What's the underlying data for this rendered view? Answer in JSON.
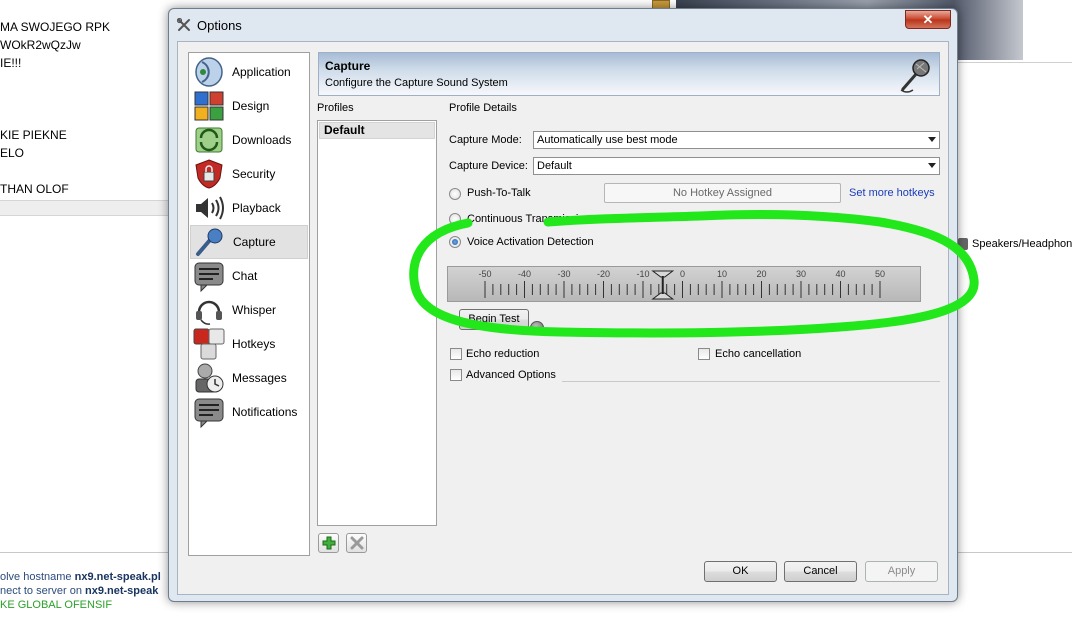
{
  "background": {
    "chat_lines": [
      "MA SWOJEGO RPK",
      "WOkR2wQzJw",
      "IE!!!",
      "KIE PIEKNE",
      "ELO",
      "THAN OLOF"
    ],
    "log": {
      "line1_prefix": "olve hostname ",
      "line1_host": "nx9.net-speak.pl",
      "line2_prefix": "nect to server on ",
      "line2_host": "nx9.net-speak",
      "line3": "KE GLOBAL OFENSIF"
    },
    "speakers_label": "Speakers/Headphone"
  },
  "dialog": {
    "title": "Options",
    "close_label": "✕"
  },
  "sidebar": {
    "items": [
      {
        "label": "Application",
        "icon": "application-icon"
      },
      {
        "label": "Design",
        "icon": "design-icon"
      },
      {
        "label": "Downloads",
        "icon": "downloads-icon"
      },
      {
        "label": "Security",
        "icon": "security-icon"
      },
      {
        "label": "Playback",
        "icon": "playback-icon"
      },
      {
        "label": "Capture",
        "icon": "capture-icon",
        "selected": true
      },
      {
        "label": "Chat",
        "icon": "chat-icon"
      },
      {
        "label": "Whisper",
        "icon": "whisper-icon"
      },
      {
        "label": "Hotkeys",
        "icon": "hotkeys-icon"
      },
      {
        "label": "Messages",
        "icon": "messages-icon"
      },
      {
        "label": "Notifications",
        "icon": "notifications-icon"
      }
    ]
  },
  "header": {
    "title": "Capture",
    "subtitle": "Configure the Capture Sound System"
  },
  "profiles": {
    "label": "Profiles",
    "items": [
      "Default"
    ]
  },
  "details": {
    "label": "Profile Details",
    "capture_mode_label": "Capture Mode:",
    "capture_mode_value": "Automatically use best mode",
    "capture_device_label": "Capture Device:",
    "capture_device_value": "Default",
    "push_to_talk_label": "Push-To-Talk",
    "hotkey_placeholder": "No Hotkey Assigned",
    "set_more_hotkeys": "Set more hotkeys",
    "continuous_label": "Continuous Transmission",
    "vad_label": "Voice Activation Detection",
    "selected_mode": "Voice Activation Detection",
    "vad_scale": {
      "ticks": [
        "-50",
        "-40",
        "-30",
        "-20",
        "-10",
        "0",
        "10",
        "20",
        "30",
        "40",
        "50"
      ],
      "min": -50,
      "max": 50,
      "threshold": -5
    },
    "begin_test_label": "Begin Test",
    "echo_reduction_label": "Echo reduction",
    "echo_cancellation_label": "Echo cancellation",
    "advanced_options_label": "Advanced Options"
  },
  "buttons": {
    "ok": "OK",
    "cancel": "Cancel",
    "apply": "Apply"
  },
  "colors": {
    "annotation": "#22e81b",
    "header_gradient": "#a7bcd5",
    "link": "#1a3db8"
  }
}
